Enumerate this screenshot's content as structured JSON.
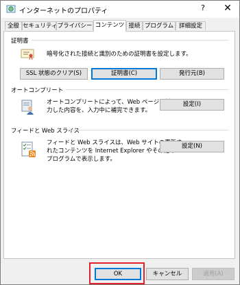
{
  "window": {
    "title": "インターネットのプロパティ",
    "help_label": "?",
    "close_label": "✕"
  },
  "tabs": [
    {
      "label": "全般"
    },
    {
      "label": "セキュリティ"
    },
    {
      "label": "プライバシー"
    },
    {
      "label": "コンテンツ",
      "active": true
    },
    {
      "label": "接続"
    },
    {
      "label": "プログラム"
    },
    {
      "label": "詳細設定"
    }
  ],
  "certificates": {
    "heading": "証明書",
    "description": "暗号化された接続と識別のための証明書を設定します。",
    "icon": "certificate-icon",
    "clear_ssl_label": "SSL 状態のクリア(S)",
    "certificates_label": "証明書(C)",
    "publishers_label": "発行元(B)"
  },
  "autocomplete": {
    "heading": "オートコンプリート",
    "description_line1": "オートコンプリートによって、Web ページで前回入",
    "description_line2": "力した内容を、入力中に補完できます。",
    "icon": "autocomplete-icon",
    "settings_label": "設定(I)"
  },
  "feeds": {
    "heading": "フィードと Web スライス",
    "description_line1": "フィードと Web スライスは、Web サイトの更新さ",
    "description_line2": "れたコンテンツを Internet Explorer やその他の",
    "description_line3": "プログラムで表示します。",
    "icon": "feeds-icon",
    "settings_label": "設定(N)"
  },
  "footer": {
    "ok_label": "OK",
    "cancel_label": "キャンセル",
    "apply_label": "適用(A)"
  },
  "colors": {
    "highlight": "#e0202a",
    "focus_border": "#0078d7"
  }
}
